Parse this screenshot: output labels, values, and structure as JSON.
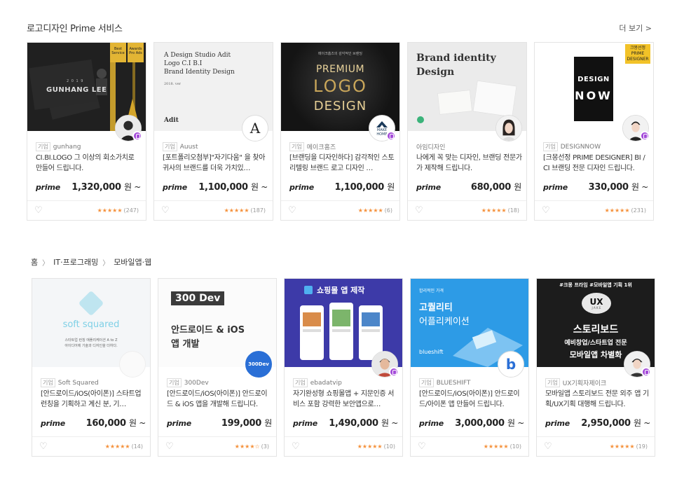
{
  "section1": {
    "title": "로고디자인 Prime 서비스",
    "more": "더 보기 >"
  },
  "section2": {
    "breadcrumb": [
      "홈",
      "IT·프로그래밍",
      "모바일앱·웹"
    ]
  },
  "biz_label": "기업",
  "prime_label": "prime",
  "row1": [
    {
      "seller": "gunhang",
      "biz": true,
      "desc": "CI.BI.LOGO 그 이상의 회소가치로 만들어 드립니다.",
      "price": "1,320,000",
      "won": "원 ~",
      "stars": "★★★★★",
      "reviews": "(247)",
      "thumb": {
        "name": "GUNHANG LEE",
        "year": "2 0 1 9",
        "badge1": "Best Service",
        "badge2": "Awards Pro Ads"
      }
    },
    {
      "seller": "Auust",
      "biz": true,
      "desc": "[포트폴리오첨부]\"자기다움\" 을 찾아 귀사의 브랜드를 더욱 가치있…",
      "price": "1,100,000",
      "won": "원 ~",
      "stars": "★★★★★",
      "reviews": "(187)",
      "thumb": {
        "lines": [
          "A Design Studio Adit",
          "Logo C.I B.I",
          "Brand Identity Design"
        ],
        "sub": "2018. ver",
        "brand": "Adit",
        "avatar": "A"
      }
    },
    {
      "seller": "메이크홈즈",
      "biz": true,
      "desc": "[브랜딩을 디자인하다] 감각적인 스토리텔링 브랜드 로고 디자인 …",
      "price": "1,100,000",
      "won": "원",
      "stars": "★★★★★",
      "reviews": "(6)",
      "thumb": {
        "top": "메이크홈즈의 감각적인 브랜딩",
        "l1": "PREMIUM",
        "l2": "LOGO",
        "l3": "DESIGN",
        "avatar": "MAKE HOME"
      }
    },
    {
      "seller": "아임디자인",
      "biz": false,
      "desc": "나에게 꼭 맞는 디자인, 브랜딩 전문가가 제작해 드립니다.",
      "price": "680,000",
      "won": "원",
      "stars": "★★★★★",
      "reviews": "(18)",
      "thumb": {
        "l1": "Brand identity",
        "l2": "Design"
      }
    },
    {
      "seller": "DESIGNNOW",
      "biz": true,
      "desc": "[크몽선정 PRIME DESIGNER] BI / CI 브랜딩 전문 디자인 드립니다.",
      "price": "330,000",
      "won": "원 ~",
      "stars": "★★★★★",
      "reviews": "(231)",
      "thumb": {
        "badge": "크몽선정 PRIME DESIGNER",
        "l1": "DESIGN",
        "l2": "NOW"
      }
    }
  ],
  "row2": [
    {
      "seller": "Soft Squared",
      "biz": true,
      "desc": "[안드로이드/iOS(아이폰)] 스타트업 런칭을 기획하고 계신 분, 기…",
      "price": "160,000",
      "won": "원 ~",
      "stars": "★★★★★",
      "reviews": "(14)",
      "thumb": {
        "brand": "soft squared",
        "sub1": "스타트업 런칭 애플리케이션 A to Z",
        "sub2": "아이디어에 기술과 디자인을 더하다."
      }
    },
    {
      "seller": "300Dev",
      "biz": true,
      "desc": "[안드로이드/iOS(아이폰)] 안드로이드 & iOS 앱을 개발해 드립니다.",
      "price": "199,000",
      "won": "원",
      "stars": "★★★★☆",
      "reviews": "(3)",
      "thumb": {
        "brand": "300 Dev",
        "l1": "안드로이드 & iOS",
        "l2": "앱 개발",
        "avatar": "300Dev"
      }
    },
    {
      "seller": "ebadatvip",
      "biz": true,
      "desc": "자기완성형 쇼핑몰앱 + 지문인증 서비스 포함 강력한 보안앱으로…",
      "price": "1,490,000",
      "won": "원 ~",
      "stars": "★★★★★",
      "reviews": "(10)",
      "thumb": {
        "title": "쇼핑몰 앱 제작"
      }
    },
    {
      "seller": "BLUESHIFT",
      "biz": true,
      "desc": "[안드로이드/iOS(아이폰)] 안드로이드/아이폰 앱 만들어 드립니다.",
      "price": "3,000,000",
      "won": "원 ~",
      "stars": "★★★★★",
      "reviews": "(10)",
      "thumb": {
        "top": "합리적인 가격",
        "l1": "고퀄리티",
        "l2": "어플리케이션",
        "brand": "blueshift",
        "avatar": "b"
      }
    },
    {
      "seller": "UX기획자제이크",
      "biz": true,
      "desc": "모바일앱 스토리보드 전문 외주 앱 기획/UX기획 대행해 드립니다.",
      "price": "2,950,000",
      "won": "원 ~",
      "stars": "★★★★★",
      "reviews": "(19)",
      "thumb": {
        "top": "#크몽 프라임 #모바일앱 기획 1위",
        "badge": "UX",
        "badge_sub": "J A K E",
        "l1": "스토리보드",
        "l2": "예비창업/스타트업 전문",
        "l3": "모바일앱 차별화"
      }
    }
  ]
}
